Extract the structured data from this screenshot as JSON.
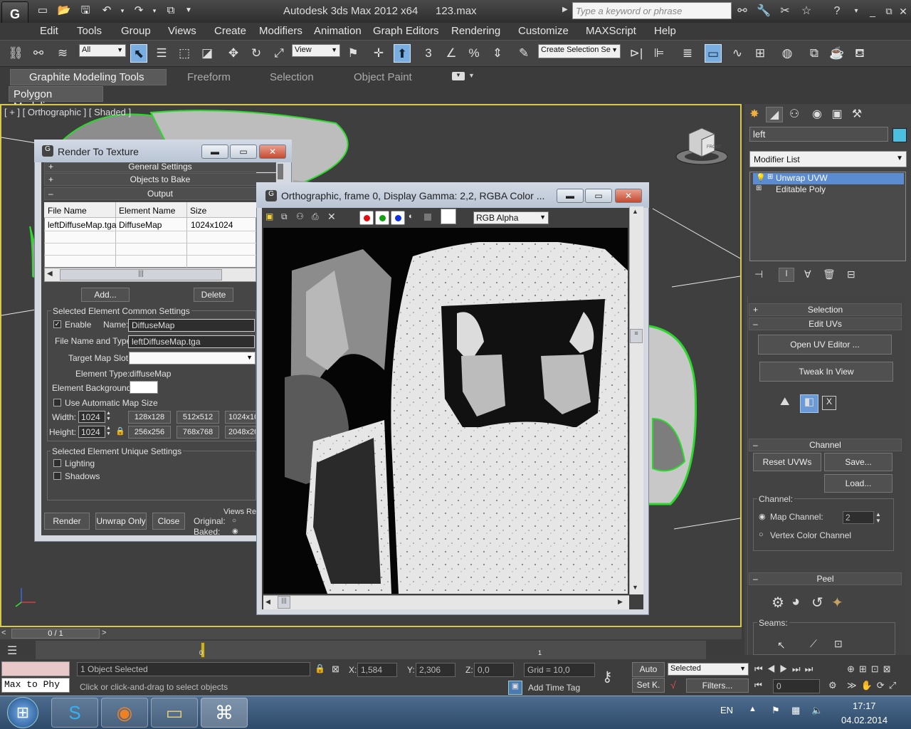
{
  "app": {
    "title": "Autodesk 3ds Max  2012 x64",
    "file": "123.max",
    "logo_text": "G",
    "search_placeholder": "Type a keyword or phrase"
  },
  "menus": [
    "Edit",
    "Tools",
    "Group",
    "Views",
    "Create",
    "Modifiers",
    "Animation",
    "Graph Editors",
    "Rendering",
    "Customize",
    "MAXScript",
    "Help"
  ],
  "toolbar": {
    "filter": "All",
    "coord_system": "View",
    "selection_set": "Create Selection Se",
    "snap_label": "3",
    "angle_label": "%",
    "active_tool": "select-object"
  },
  "ribbon": {
    "tabs": [
      "Graphite Modeling Tools",
      "Freeform",
      "Selection",
      "Object Paint"
    ],
    "panel": "Polygon Modeling"
  },
  "viewport": {
    "label": "[ + ] [ Orthographic ] [ Shaded ]",
    "viewcube_face": "FRONT",
    "wire_color": "#2bd82b",
    "border_color": "#d8c94a"
  },
  "command_panel": {
    "object_name": "left",
    "object_color": "#4bbfe0",
    "modifier_list": "Modifier List",
    "stack": [
      "Unwrap UVW",
      "Editable Poly"
    ],
    "selected_stack_index": 0,
    "rollouts": {
      "selection": "Selection",
      "edit_uvs": "Edit UVs",
      "open_uv_editor": "Open UV Editor ...",
      "tweak_in_view": "Tweak In View",
      "channel": "Channel",
      "reset_uvws": "Reset UVWs",
      "save": "Save...",
      "load": "Load...",
      "channel_label": "Channel:",
      "map_channel": "Map Channel:",
      "map_channel_value": "2",
      "vertex_color_channel": "Vertex Color Channel",
      "peel": "Peel",
      "seams": "Seams:"
    }
  },
  "render_to_texture": {
    "title": "Render To Texture",
    "sections": [
      "General Settings",
      "Objects to Bake",
      "Output"
    ],
    "columns": [
      "File Name",
      "Element Name",
      "Size"
    ],
    "rows": [
      [
        "leftDiffuseMap.tga",
        "DiffuseMap",
        "1024x1024"
      ]
    ],
    "add": "Add...",
    "delete": "Delete",
    "common_group": "Selected Element Common Settings",
    "enable": "Enable",
    "name_label": "Name:",
    "name_value": "DiffuseMap",
    "file_type_label": "File Name and Type:",
    "file_type_value": "leftDiffuseMap.tga",
    "target_slot_label": "Target Map Slot:",
    "element_type_label": "Element Type:",
    "element_type_value": "diffuseMap",
    "element_bg_label": "Element Background:",
    "auto_map_size": "Use Automatic Map Size",
    "width_label": "Width:",
    "height_label": "Height:",
    "width_value": "1024",
    "height_value": "1024",
    "size_presets": [
      "128x128",
      "512x512",
      "1024x10",
      "256x256",
      "768x768",
      "2048x20"
    ],
    "unique_group": "Selected Element Unique Settings",
    "lighting": "Lighting",
    "shadows": "Shadows",
    "render": "Render",
    "unwrap_only": "Unwrap Only",
    "close": "Close",
    "views": "Views",
    "re": "Re",
    "original": "Original:",
    "baked": "Baked:"
  },
  "frame_window": {
    "title": "Orthographic, frame 0, Display Gamma: 2,2, RGBA Color ...",
    "channel_dropdown": "RGB Alpha",
    "channel_colors": [
      "#e01010",
      "#10a010",
      "#1030e0"
    ]
  },
  "timeline": {
    "frame_counter": "0 / 1",
    "ruler_labels": [
      "0",
      "1"
    ]
  },
  "status": {
    "script_listener": "Max to Phy",
    "objects_selected": "1 Object Selected",
    "prompt": "Click or click-and-drag to select objects",
    "x_label": "X:",
    "x_value": "1,584",
    "y_label": "Y:",
    "y_value": "2,306",
    "z_label": "Z:",
    "z_value": "0,0",
    "grid": "Grid = 10,0",
    "add_time_tag": "Add Time Tag",
    "auto": "Auto",
    "set_key": "Set K.",
    "key_filter": "Selected",
    "filters": "Filters...",
    "frame_value": "0"
  },
  "taskbar": {
    "language": "EN",
    "time": "17:17",
    "date": "04.02.2014"
  }
}
